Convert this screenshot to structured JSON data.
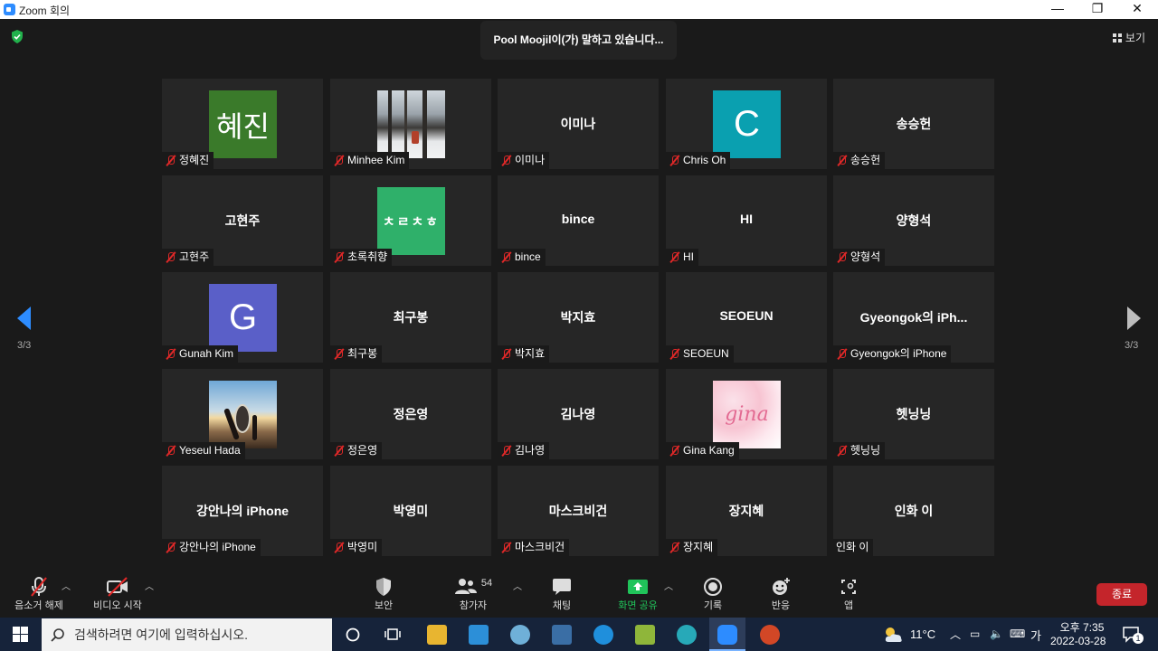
{
  "window": {
    "title": "Zoom 회의",
    "min": "—",
    "max": "❐",
    "close": "✕"
  },
  "top": {
    "speaking": "Pool Moojil이(가) 말하고 있습니다...",
    "view_label": "보기",
    "page_left": "3/3",
    "page_right": "3/3"
  },
  "tiles": [
    {
      "label": "정혜진",
      "avatar": "혜진",
      "avatar_color": "#3a7a2a"
    },
    {
      "label": "Minhee Kim",
      "photo": "snow-forest"
    },
    {
      "center": "이미나",
      "label": "이미나"
    },
    {
      "label": "Chris Oh",
      "avatar": "C",
      "avatar_color": "#0aa0b0"
    },
    {
      "center": "송승헌",
      "label": "송승헌"
    },
    {
      "center": "고현주",
      "label": "고현주"
    },
    {
      "label": "초록취향",
      "avatar": "ㅊㄹㅊㅎ",
      "avatar_color": "#2fb06a"
    },
    {
      "center": "bince",
      "label": "bince"
    },
    {
      "center": "HI",
      "label": "HI"
    },
    {
      "center": "양형석",
      "label": "양형석"
    },
    {
      "label": "Gunah Kim",
      "avatar": "G",
      "avatar_color": "#5a5fc8"
    },
    {
      "center": "최구봉",
      "label": "최구봉"
    },
    {
      "center": "박지효",
      "label": "박지효"
    },
    {
      "center": "SEOEUN",
      "label": "SEOEUN"
    },
    {
      "center": "Gyeongok의 iPh...",
      "label": "Gyeongok의 iPhone"
    },
    {
      "label": "Yeseul Hada",
      "photo": "beach-surf"
    },
    {
      "center": "정은영",
      "label": "정은영"
    },
    {
      "center": "김나영",
      "label": "김나영"
    },
    {
      "label": "Gina Kang",
      "photo": "gina-pink",
      "photo_text": "gina"
    },
    {
      "center": "헷닝닝",
      "label": "헷닝닝"
    },
    {
      "center": "강안나의 iPhone",
      "label": "강안나의 iPhone"
    },
    {
      "center": "박영미",
      "label": "박영미"
    },
    {
      "center": "마스크비건",
      "label": "마스크비건"
    },
    {
      "center": "장지혜",
      "label": "장지혜"
    },
    {
      "center": "인화 이",
      "label": "인화 이",
      "unmuted": true
    }
  ],
  "toolbar": {
    "unmute": "음소거 해제",
    "start_video": "비디오 시작",
    "security": "보안",
    "participants": "참가자",
    "participants_count": "54",
    "chat": "채팅",
    "share": "화면 공유",
    "record": "기록",
    "reactions": "반응",
    "apps": "앱",
    "end": "종료"
  },
  "taskbar": {
    "search_placeholder": "검색하려면 여기에 입력하십시오.",
    "weather": "11°C",
    "ime": "가",
    "time": "오후 7:35",
    "date": "2022-03-28",
    "notification_count": "1"
  },
  "colors": {
    "accent": "#2d8cff",
    "share_green": "#20c45a",
    "end_red": "#c4252b"
  }
}
